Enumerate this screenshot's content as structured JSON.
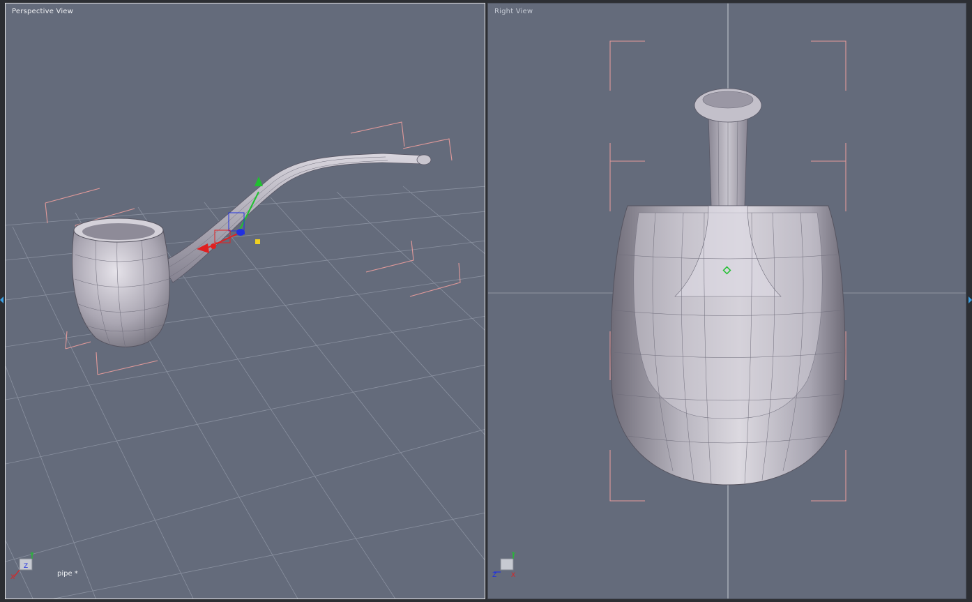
{
  "viewports": {
    "perspective": {
      "title": "Perspective View",
      "object_label": "pipe *"
    },
    "right": {
      "title": "Right View"
    }
  },
  "axis_labels": {
    "perspective": {
      "y": "Y",
      "x": "X",
      "z": "Z"
    },
    "right": {
      "y": "Y",
      "z": "Z",
      "x": "X"
    }
  },
  "colors": {
    "viewport_bg": "#646b7b",
    "grid": "#8a91a0",
    "bounding_frame": "#e39a9a",
    "gizmo_x": "#e02020",
    "gizmo_y": "#20c030",
    "gizmo_z": "#2030e0",
    "pivot": "#f0d020",
    "selection_accent": "#3aa0e6"
  },
  "icons": [
    "axis-cube-icon",
    "move-gizmo-icon",
    "pivot-point-icon",
    "edge-arrow-icon"
  ]
}
